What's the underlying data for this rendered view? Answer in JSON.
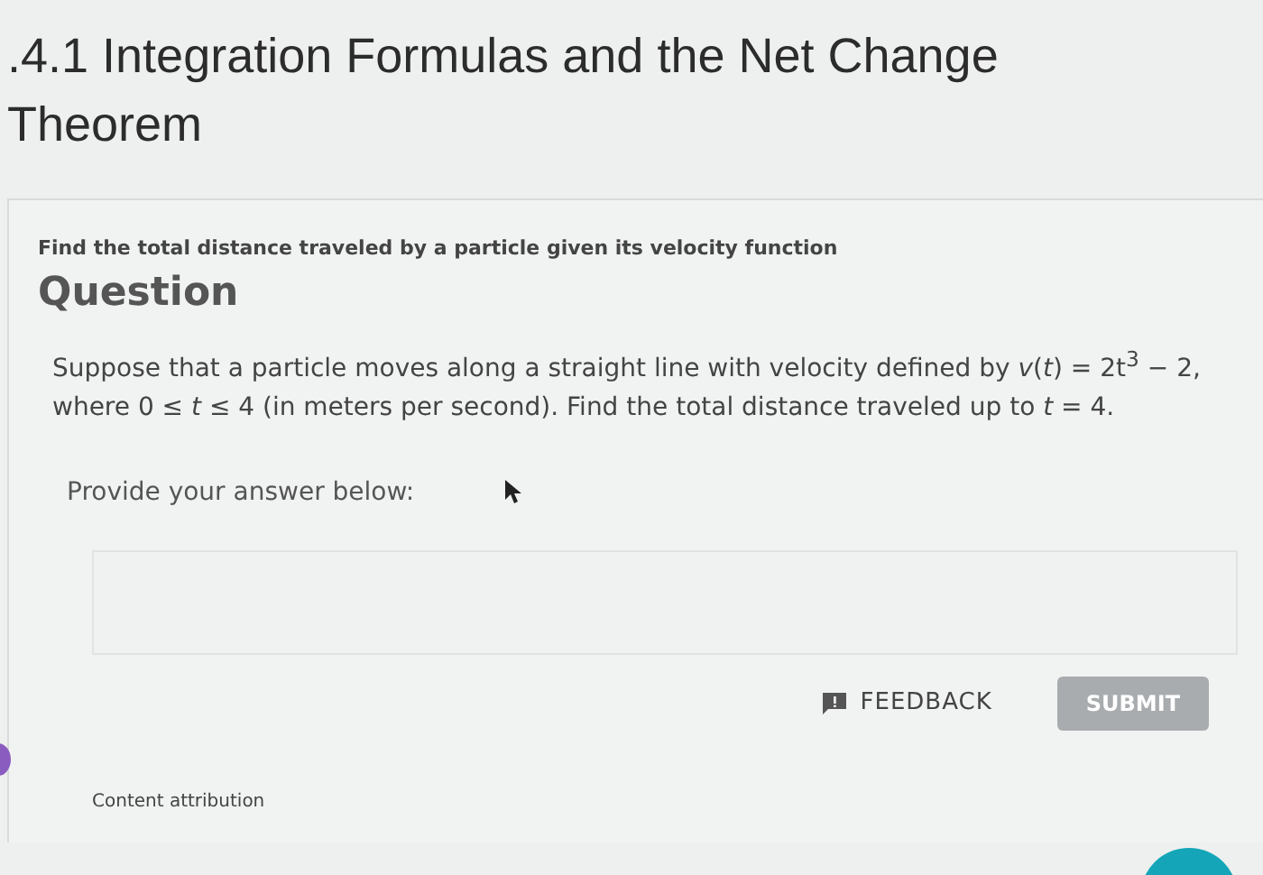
{
  "page_title": ".4.1 Integration Formulas and the Net Change Theorem",
  "subtitle": "Find the total distance traveled by a particle given its velocity function",
  "question": {
    "heading": "Question",
    "text": "Suppose that a particle moves along a straight line with velocity defined by *v*(*t*) = 2t$^{3}$ − 2, where 0 ≤ *t* ≤ 4 (in meters per second). Find the total distance traveled up to *t* = 4."
  },
  "answer": {
    "prompt": "Provide your answer below:"
  },
  "feedback_button": "FEEDBACK",
  "submit_button": {
    "label": "SUBMIT",
    "disabled": true
  },
  "footer": "Content attribution"
}
